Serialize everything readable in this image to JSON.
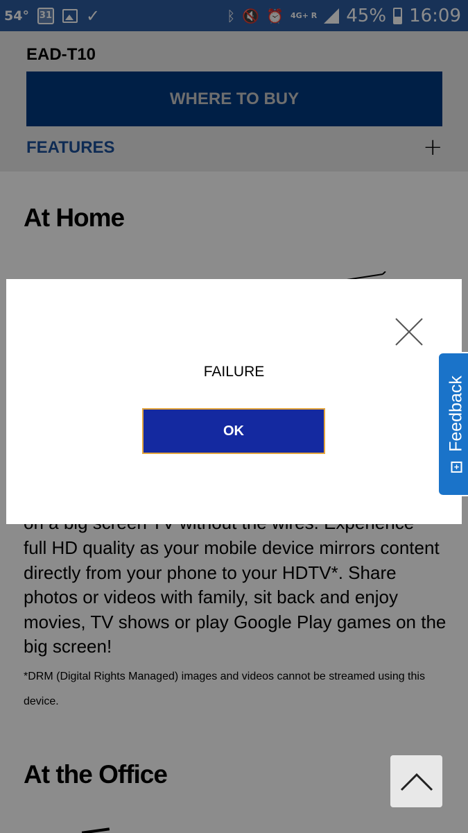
{
  "status_bar": {
    "temperature": "54°",
    "calendar_day": "31",
    "network": "4G+",
    "roaming": "R",
    "battery_percent": "45%",
    "battery_level": 0.45,
    "time": "16:09",
    "icons": [
      "calendar-icon",
      "image-icon",
      "check-icon",
      "bluetooth-icon",
      "mute-icon",
      "alarm-icon",
      "signal-icon",
      "battery-icon"
    ]
  },
  "header": {
    "model": "EAD-T10",
    "where_to_buy": "WHERE TO BUY",
    "features_label": "FEATURES",
    "expand_symbol": "+"
  },
  "content": {
    "at_home_title": "At Home",
    "body_partial": "on a big screen TV without the wires. Experience",
    "body_text": "full HD quality as your mobile device mirrors content directly from your phone to your HDTV*. Share photos or videos with family, sit back and enjoy movies, TV shows or play Google Play games on the big screen!",
    "drm_note": "*DRM (Digital Rights Managed) images and videos cannot be streamed using this device.",
    "at_office_title": "At the Office"
  },
  "modal": {
    "message": "FAILURE",
    "ok_label": "OK"
  },
  "feedback": {
    "label": "Feedback",
    "icon_glyph": "+"
  },
  "colors": {
    "status_bar": "#2d5b9e",
    "buy_button": "#003a80",
    "features_text": "#1a4f99",
    "ok_button": "#1429a0",
    "ok_border": "#e3a53d",
    "feedback_tab": "#1a73c9"
  }
}
